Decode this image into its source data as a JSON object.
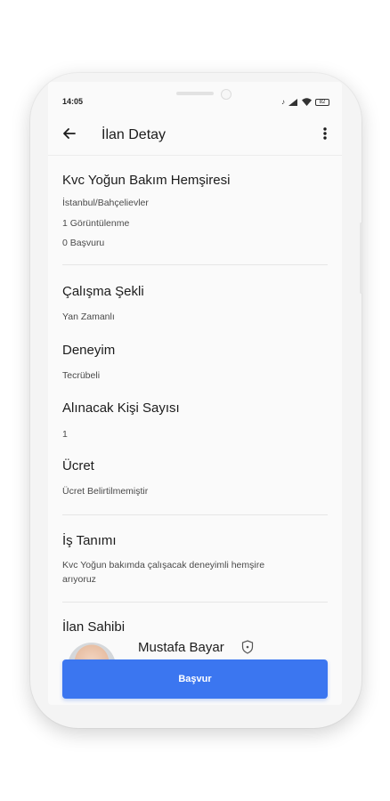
{
  "status_bar": {
    "time": "14:05",
    "battery": "82"
  },
  "appbar": {
    "title": "İlan Detay",
    "back_icon": "arrow-left-icon",
    "menu_icon": "more-vertical-icon"
  },
  "job": {
    "title": "Kvc Yoğun Bakım Hemşiresi",
    "location": "İstanbul/Bahçelievler",
    "views": "1 Görüntülenme",
    "applications": "0 Başvuru"
  },
  "details": [
    {
      "label": "Çalışma Şekli",
      "value": "Yan Zamanlı"
    },
    {
      "label": "Deneyim",
      "value": "Tecrübeli"
    },
    {
      "label": "Alınacak Kişi Sayısı",
      "value": "1"
    },
    {
      "label": "Ücret",
      "value": "Ücret Belirtilmemiştir"
    }
  ],
  "description": {
    "label": "İş Tanımı",
    "line1": "Kvc Yoğun bakımda çalışacak deneyimli hemşire",
    "line2": "arıyoruz"
  },
  "owner": {
    "label": "İlan Sahibi",
    "name": "Mustafa Bayar",
    "verified_icon": "shield-check-icon"
  },
  "cta": {
    "apply_label": "Başvur"
  },
  "colors": {
    "accent": "#3b76f0"
  }
}
